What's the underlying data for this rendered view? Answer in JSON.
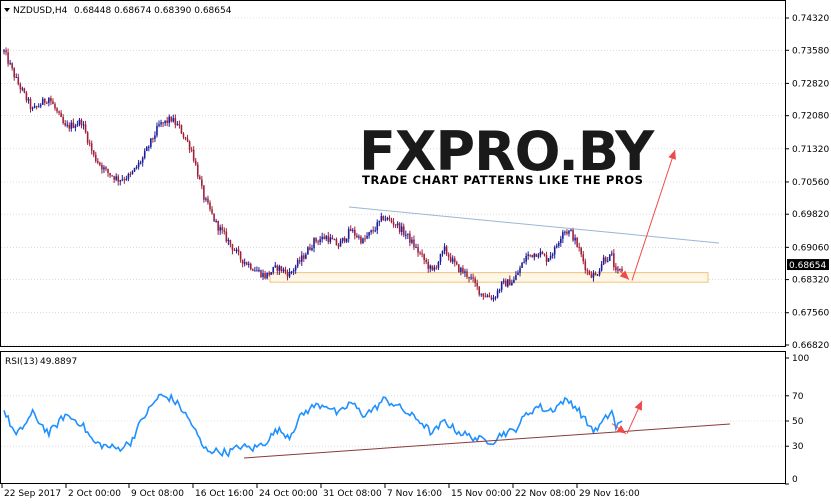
{
  "header": {
    "title": "NZDUSD,H4",
    "ohlc": "0.68448 0.68674 0.68390 0.68654"
  },
  "logo": {
    "text": "FXPRO.BY",
    "tagline": "TRADE CHART PATTERNS LIKE THE PROS"
  },
  "colors": {
    "bull": "#1c1c9a",
    "bear": "#a0203a",
    "rsi": "#1e90ff",
    "trend_upper": "#9ab7d3",
    "trend_rsi": "#8a3a3a",
    "arrow": "#ee4a4a",
    "zone_stroke": "#f0c27a",
    "zone_fill": "#fff7e6",
    "grid": "#c8c8c8",
    "price_tag": "#000000"
  },
  "chart_data": [
    {
      "type": "candlestick",
      "symbol": "NZDUSD",
      "timeframe": "H4",
      "ylim": [
        0.6682,
        0.7432
      ],
      "yticks": [
        "0.74320",
        "0.73580",
        "0.72820",
        "0.72080",
        "0.71320",
        "0.70560",
        "0.69820",
        "0.69060",
        "0.68320",
        "0.67560",
        "0.66820"
      ],
      "current_price": "0.68654",
      "xticks": [
        "22 Sep 2017",
        "2 Oct 00:00",
        "9 Oct 08:00",
        "16 Oct 16:00",
        "24 Oct 00:00",
        "31 Oct 08:00",
        "7 Nov 16:00",
        "15 Nov 00:00",
        "22 Nov 08:00",
        "29 Nov 16:00"
      ],
      "anchors": [
        [
          0,
          0.7355
        ],
        [
          6,
          0.729
        ],
        [
          14,
          0.722
        ],
        [
          22,
          0.725
        ],
        [
          30,
          0.718
        ],
        [
          38,
          0.7195
        ],
        [
          44,
          0.7115
        ],
        [
          50,
          0.708
        ],
        [
          56,
          0.7062
        ],
        [
          62,
          0.707
        ],
        [
          68,
          0.711
        ],
        [
          76,
          0.7185
        ],
        [
          82,
          0.72
        ],
        [
          86,
          0.718
        ],
        [
          92,
          0.713
        ],
        [
          98,
          0.702
        ],
        [
          104,
          0.696
        ],
        [
          110,
          0.692
        ],
        [
          116,
          0.688
        ],
        [
          122,
          0.686
        ],
        [
          128,
          0.684
        ],
        [
          134,
          0.686
        ],
        [
          140,
          0.6845
        ],
        [
          146,
          0.688
        ],
        [
          152,
          0.692
        ],
        [
          158,
          0.693
        ],
        [
          164,
          0.691
        ],
        [
          170,
          0.6945
        ],
        [
          176,
          0.692
        ],
        [
          182,
          0.695
        ],
        [
          186,
          0.6975
        ],
        [
          192,
          0.696
        ],
        [
          198,
          0.693
        ],
        [
          204,
          0.689
        ],
        [
          210,
          0.685
        ],
        [
          216,
          0.69
        ],
        [
          222,
          0.686
        ],
        [
          228,
          0.684
        ],
        [
          234,
          0.68
        ],
        [
          240,
          0.679
        ],
        [
          244,
          0.682
        ],
        [
          250,
          0.683
        ],
        [
          256,
          0.6885
        ],
        [
          262,
          0.6895
        ],
        [
          266,
          0.688
        ],
        [
          270,
          0.69
        ],
        [
          274,
          0.6945
        ],
        [
          278,
          0.694
        ],
        [
          282,
          0.69
        ],
        [
          286,
          0.685
        ],
        [
          290,
          0.684
        ],
        [
          294,
          0.688
        ],
        [
          298,
          0.6885
        ],
        [
          300,
          0.6845
        ],
        [
          303,
          0.6855
        ]
      ]
    },
    {
      "type": "line",
      "name": "RSI(13)",
      "value": "49.8897",
      "ylim": [
        0,
        100
      ],
      "yticks": [
        100,
        70,
        50,
        30,
        0
      ],
      "anchors": [
        [
          0,
          58
        ],
        [
          6,
          38
        ],
        [
          14,
          56
        ],
        [
          22,
          40
        ],
        [
          30,
          55
        ],
        [
          38,
          48
        ],
        [
          44,
          33
        ],
        [
          50,
          30
        ],
        [
          56,
          28
        ],
        [
          62,
          33
        ],
        [
          68,
          52
        ],
        [
          76,
          70
        ],
        [
          82,
          68
        ],
        [
          86,
          62
        ],
        [
          92,
          48
        ],
        [
          98,
          28
        ],
        [
          104,
          26
        ],
        [
          110,
          25
        ],
        [
          116,
          30
        ],
        [
          122,
          28
        ],
        [
          128,
          33
        ],
        [
          134,
          43
        ],
        [
          140,
          38
        ],
        [
          146,
          55
        ],
        [
          152,
          62
        ],
        [
          158,
          63
        ],
        [
          164,
          55
        ],
        [
          170,
          65
        ],
        [
          176,
          55
        ],
        [
          182,
          60
        ],
        [
          186,
          67
        ],
        [
          192,
          63
        ],
        [
          198,
          56
        ],
        [
          204,
          50
        ],
        [
          210,
          40
        ],
        [
          216,
          50
        ],
        [
          222,
          42
        ],
        [
          228,
          38
        ],
        [
          234,
          35
        ],
        [
          240,
          34
        ],
        [
          244,
          40
        ],
        [
          250,
          42
        ],
        [
          256,
          55
        ],
        [
          262,
          62
        ],
        [
          266,
          58
        ],
        [
          270,
          60
        ],
        [
          274,
          66
        ],
        [
          278,
          65
        ],
        [
          282,
          58
        ],
        [
          286,
          48
        ],
        [
          290,
          42
        ],
        [
          294,
          50
        ],
        [
          298,
          58
        ],
        [
          300,
          45
        ],
        [
          303,
          49.9
        ]
      ]
    }
  ]
}
